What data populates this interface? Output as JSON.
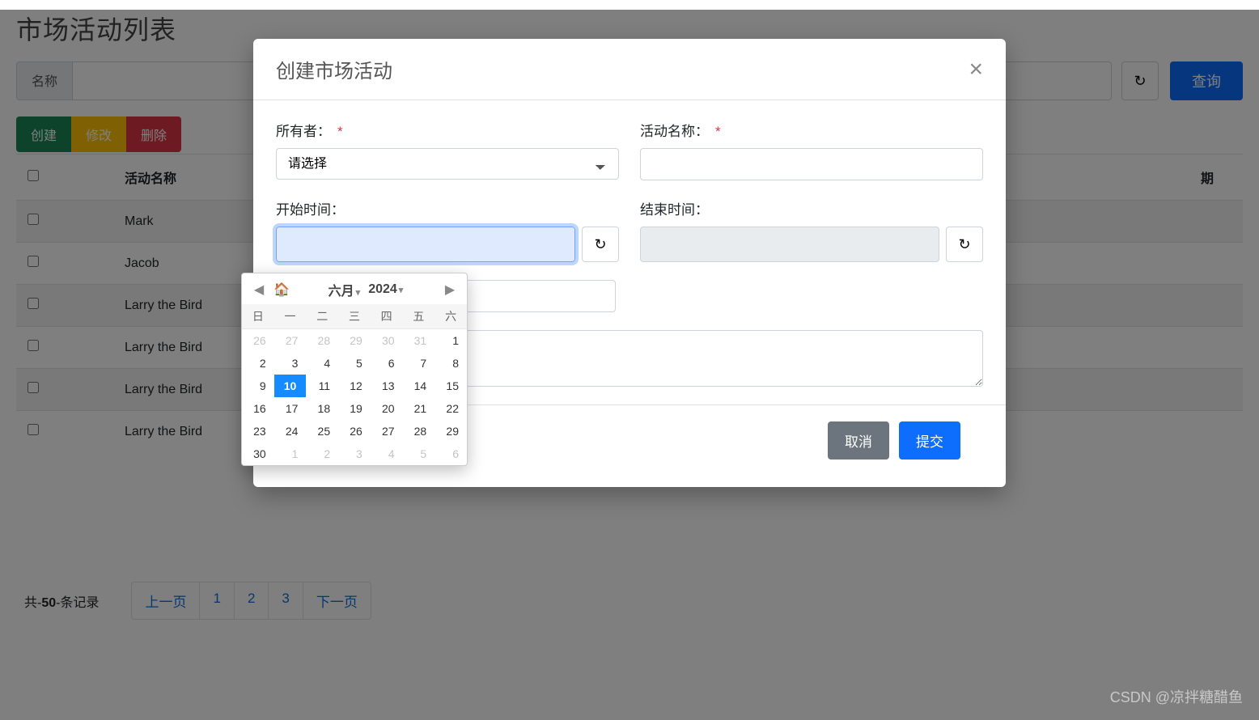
{
  "page": {
    "title": "市场活动列表"
  },
  "search": {
    "label": "名称",
    "query_btn": "查询"
  },
  "actions": {
    "create": "创建",
    "edit": "修改",
    "delete": "删除"
  },
  "table": {
    "headers": [
      "活动名称",
      "期"
    ],
    "rows": [
      "Mark",
      "Jacob",
      "Larry the Bird",
      "Larry the Bird",
      "Larry the Bird",
      "Larry the Bird"
    ]
  },
  "footer": {
    "records_prefix": "共-",
    "records_value": "50",
    "records_suffix": "-条记录",
    "prev": "上一页",
    "pages": [
      "1",
      "2",
      "3"
    ],
    "next": "下一页"
  },
  "modal": {
    "title": "创建市场活动",
    "owner_label": "所有者：",
    "owner_placeholder": "请选择",
    "name_label": "活动名称：",
    "start_label": "开始时间：",
    "end_label": "结束时间：",
    "desc_value": "",
    "cancel": "取消",
    "submit": "提交"
  },
  "datepicker": {
    "month": "六月",
    "year": "2024",
    "weekdays": [
      "日",
      "一",
      "二",
      "三",
      "四",
      "五",
      "六"
    ],
    "cells": [
      [
        {
          "v": "26",
          "m": true
        },
        {
          "v": "27",
          "m": true
        },
        {
          "v": "28",
          "m": true
        },
        {
          "v": "29",
          "m": true
        },
        {
          "v": "30",
          "m": true
        },
        {
          "v": "31",
          "m": true
        },
        {
          "v": "1"
        }
      ],
      [
        {
          "v": "2"
        },
        {
          "v": "3"
        },
        {
          "v": "4"
        },
        {
          "v": "5"
        },
        {
          "v": "6"
        },
        {
          "v": "7"
        },
        {
          "v": "8"
        }
      ],
      [
        {
          "v": "9"
        },
        {
          "v": "10",
          "sel": true
        },
        {
          "v": "11"
        },
        {
          "v": "12"
        },
        {
          "v": "13"
        },
        {
          "v": "14"
        },
        {
          "v": "15"
        }
      ],
      [
        {
          "v": "16"
        },
        {
          "v": "17"
        },
        {
          "v": "18"
        },
        {
          "v": "19"
        },
        {
          "v": "20"
        },
        {
          "v": "21"
        },
        {
          "v": "22"
        }
      ],
      [
        {
          "v": "23"
        },
        {
          "v": "24"
        },
        {
          "v": "25"
        },
        {
          "v": "26"
        },
        {
          "v": "27"
        },
        {
          "v": "28"
        },
        {
          "v": "29"
        }
      ],
      [
        {
          "v": "30"
        },
        {
          "v": "1",
          "m": true
        },
        {
          "v": "2",
          "m": true
        },
        {
          "v": "3",
          "m": true
        },
        {
          "v": "4",
          "m": true
        },
        {
          "v": "5",
          "m": true
        },
        {
          "v": "6",
          "m": true
        }
      ]
    ]
  },
  "watermark": "CSDN @凉拌糖醋鱼"
}
